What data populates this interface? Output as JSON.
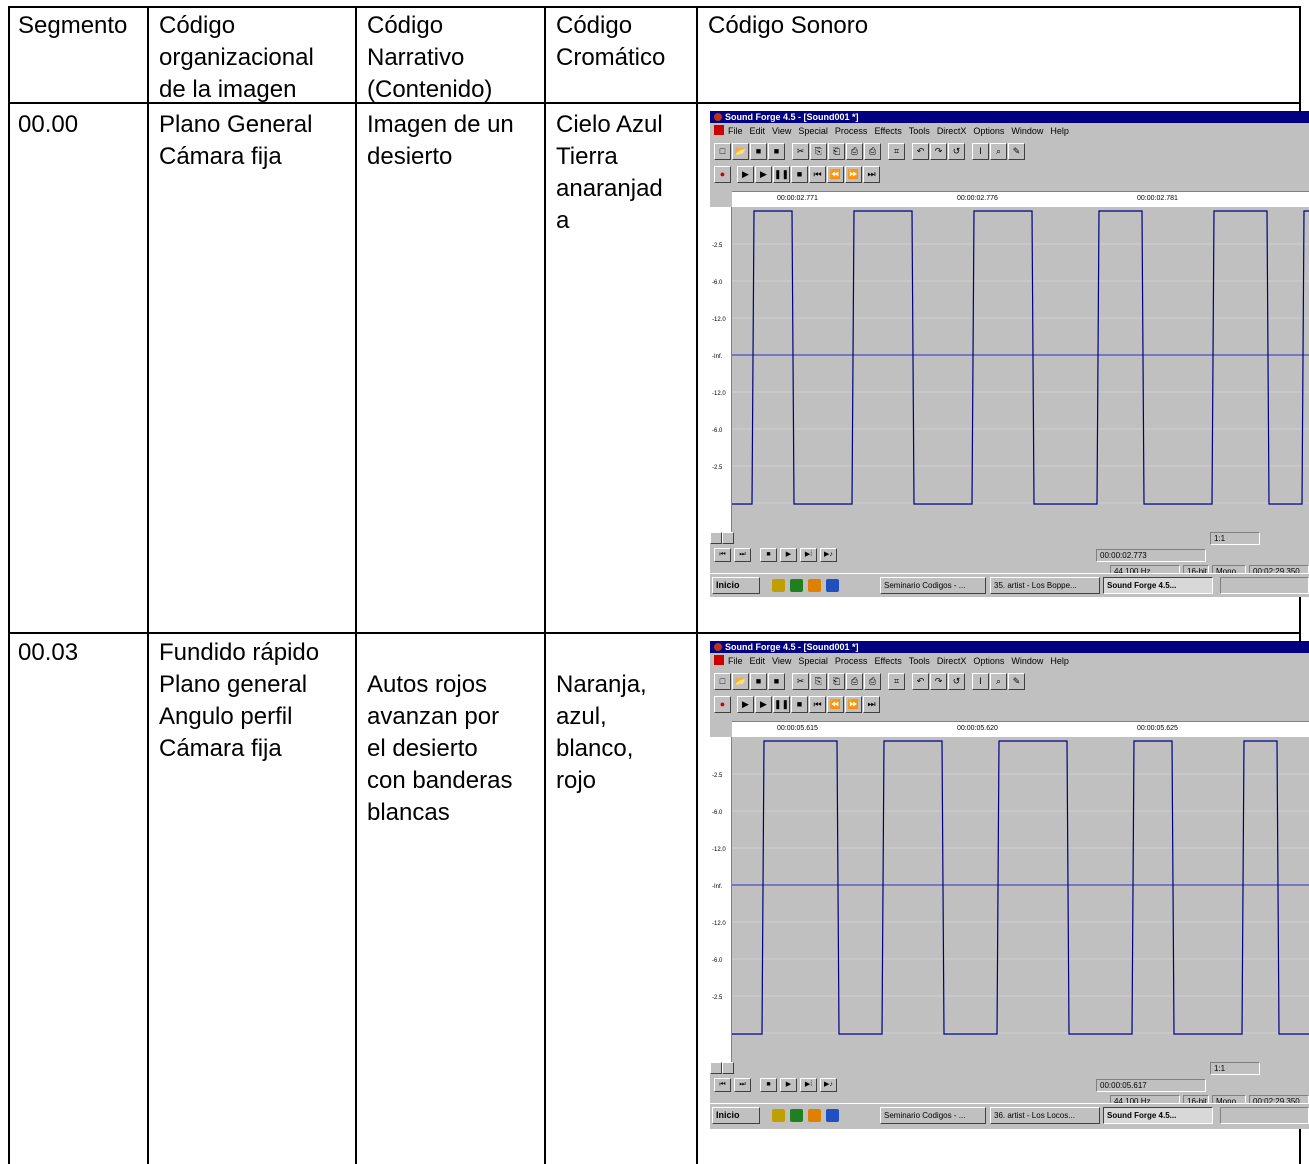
{
  "table": {
    "headers": [
      "Segmento",
      "Código\norganizacional\nde la imagen",
      "Código\nNarrativo\n(Contenido)",
      "Código\nCromático",
      "Código Sonoro"
    ],
    "rows": [
      {
        "segment": "00.00",
        "organizational": "Plano General\nCámara fija",
        "narrative": "Imagen de un\ndesierto",
        "chromatic": "Cielo Azul\nTierra\nanaranjad\na"
      },
      {
        "segment": "00.03",
        "organizational": "Fundido rápido\nPlano general\nAngulo perfil\nCámara fija",
        "narrative": "Autos rojos\navanzan por\nel desierto\ncon banderas\nblancas",
        "chromatic": "Naranja,\nazul,\nblanco,\nrojo"
      }
    ]
  },
  "screens": [
    {
      "title": "Sound Forge 4.5 - [Sound001 *]",
      "menu": [
        "File",
        "Edit",
        "View",
        "Special",
        "Process",
        "Effects",
        "Tools",
        "DirectX",
        "Options",
        "Window",
        "Help"
      ],
      "ruler": [
        "00:00:02.771",
        "00:00:02.776",
        "00:00:02.781"
      ],
      "db_labels": [
        "-2.5",
        "-6.0",
        "-12.0",
        "-Inf.",
        "-12.0",
        "-6.0",
        "-2.5"
      ],
      "zoom": "1:1",
      "position": "00:00:02.773",
      "status": [
        "44,100 Hz",
        "16-bit",
        "Mono",
        "00:02:29.350"
      ],
      "taskbar": [
        "Inicio",
        "Seminario Codigos - ...",
        "35. artist - Los Boppe...",
        "Sound Forge 4.5..."
      ],
      "wave_color": "#000080"
    },
    {
      "title": "Sound Forge 4.5 - [Sound001 *]",
      "menu": [
        "File",
        "Edit",
        "View",
        "Special",
        "Process",
        "Effects",
        "Tools",
        "DirectX",
        "Options",
        "Window",
        "Help"
      ],
      "ruler": [
        "00:00:05.615",
        "00:00:05.620",
        "00:00:05.625"
      ],
      "db_labels": [
        "-2.5",
        "-6.0",
        "-12.0",
        "-Inf.",
        "-12.0",
        "-6.0",
        "-2.5"
      ],
      "zoom": "1:1",
      "position": "00:00:05.617",
      "status": [
        "44,100 Hz",
        "16-bit",
        "Mono",
        "00:02:29.350"
      ],
      "taskbar": [
        "Inicio",
        "Seminario Codigos - ...",
        "36. artist - Los Locos...",
        "Sound Forge 4.5..."
      ],
      "wave_color": "#000080"
    }
  ]
}
